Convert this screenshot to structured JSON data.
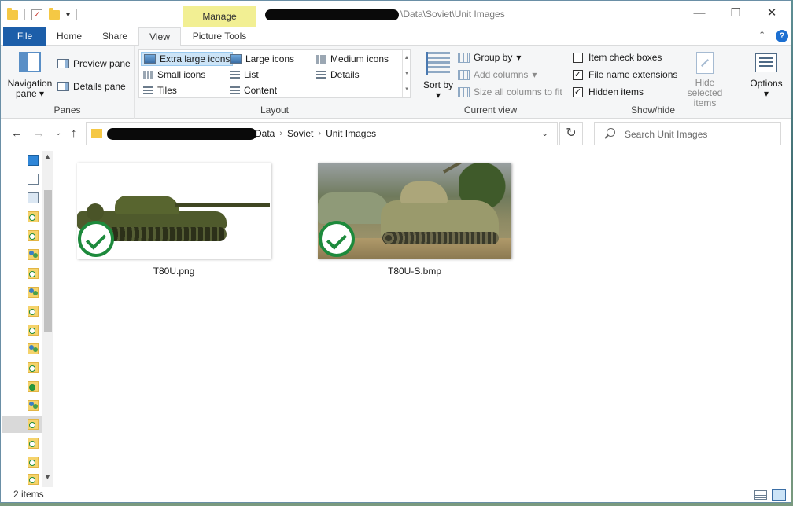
{
  "window": {
    "title_path": "\\Data\\Soviet\\Unit Images",
    "manage_label": "Manage"
  },
  "tabs": {
    "file": "File",
    "home": "Home",
    "share": "Share",
    "view": "View",
    "picture_tools": "Picture Tools"
  },
  "ribbon": {
    "panes": {
      "group_label": "Panes",
      "navigation_pane": "Navigation pane",
      "preview_pane": "Preview pane",
      "details_pane": "Details pane"
    },
    "layout": {
      "group_label": "Layout",
      "extra_large_icons": "Extra large icons",
      "large_icons": "Large icons",
      "medium_icons": "Medium icons",
      "small_icons": "Small icons",
      "list": "List",
      "details": "Details",
      "tiles": "Tiles",
      "content": "Content",
      "selected": "Extra large icons"
    },
    "current_view": {
      "group_label": "Current view",
      "sort_by": "Sort by",
      "group_by": "Group by",
      "add_columns": "Add columns",
      "size_all_columns": "Size all columns to fit"
    },
    "show_hide": {
      "group_label": "Show/hide",
      "item_check_boxes": "Item check boxes",
      "item_check_boxes_checked": false,
      "file_name_extensions": "File name extensions",
      "file_name_extensions_checked": true,
      "hidden_items": "Hidden items",
      "hidden_items_checked": true,
      "hide_selected_items": "Hide selected items"
    },
    "options": "Options"
  },
  "address": {
    "crumbs": [
      "Data",
      "Soviet",
      "Unit Images"
    ],
    "search_placeholder": "Search Unit Images"
  },
  "files": [
    {
      "name": "T80U.png",
      "status": "synced"
    },
    {
      "name": "T80U-S.bmp",
      "status": "synced"
    }
  ],
  "status": {
    "item_count": "2 items"
  },
  "colors": {
    "file_tab": "#1c5ea9",
    "manage_tab": "#f2ef93",
    "selection": "#cce4f7",
    "sync_green": "#1d8a3c"
  }
}
